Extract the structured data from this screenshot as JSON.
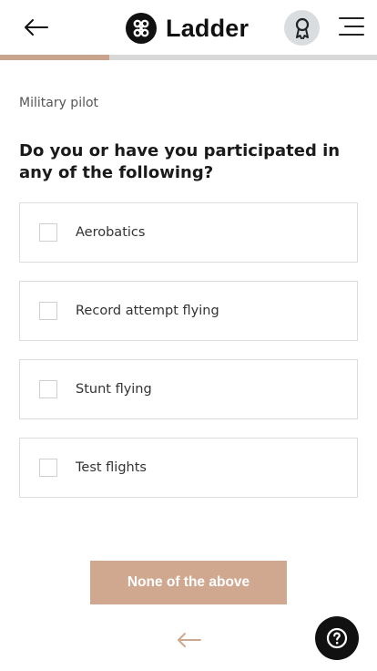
{
  "header": {
    "brand_name": "Ladder",
    "back_icon": "arrow-left-icon",
    "logo_icon": "ladder-logo-icon",
    "badge_icon": "award-ribbon-icon",
    "menu_icon": "hamburger-menu-icon"
  },
  "progress": {
    "fraction": 0.29,
    "fill_color": "#c8a48c",
    "track_color": "#d8d8d8"
  },
  "form": {
    "category": "Military pilot",
    "question": "Do you or have you participated in any of the following?",
    "options": [
      {
        "label": "Aerobatics",
        "checked": false
      },
      {
        "label": "Record attempt flying",
        "checked": false
      },
      {
        "label": "Stunt flying",
        "checked": false
      },
      {
        "label": "Test flights",
        "checked": false
      }
    ],
    "none_button_label": "None of the above"
  },
  "footer": {
    "prev_icon": "arrow-left-icon",
    "help_icon": "question-mark-icon"
  },
  "colors": {
    "accent": "#cfa88f",
    "text": "#1a1a1a",
    "border": "#dcdcdc"
  }
}
